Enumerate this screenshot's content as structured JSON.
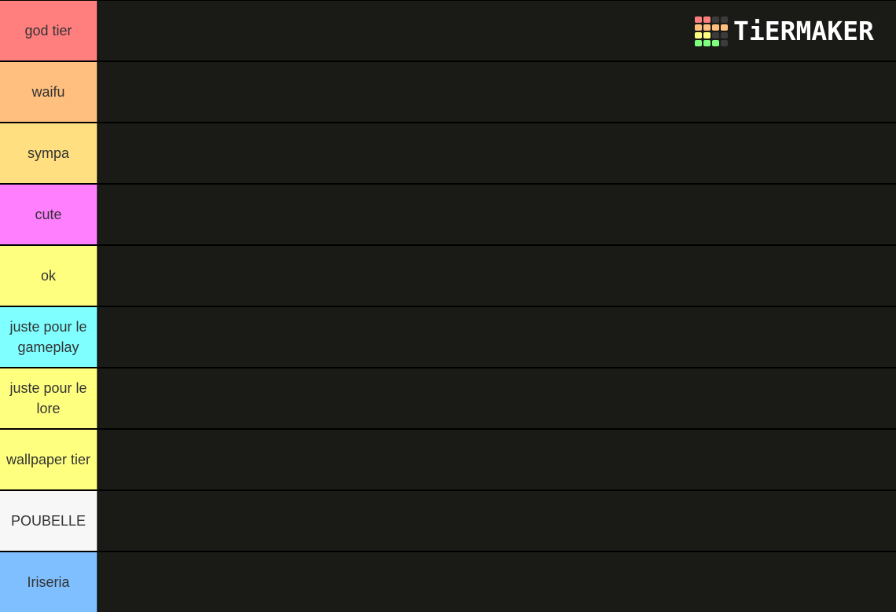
{
  "logo": {
    "text": "TiERMAKER",
    "grid_colors": [
      "#ff7f7f",
      "#ff7f7f",
      "#3b3b3b",
      "#3b3b3b",
      "#ffbf7f",
      "#ffbf7f",
      "#ffbf7f",
      "#ffbf7f",
      "#ffff7f",
      "#ffff7f",
      "#3b3b3b",
      "#3b3b3b",
      "#7fff7f",
      "#7fff7f",
      "#7fff7f",
      "#3b3b3b"
    ]
  },
  "tiers": [
    {
      "label": "god  tier",
      "color": "#ff7f7f"
    },
    {
      "label": "waifu",
      "color": "#ffbf7f"
    },
    {
      "label": "sympa",
      "color": "#ffdf7f"
    },
    {
      "label": "cute",
      "color": "#ff7fff"
    },
    {
      "label": "ok",
      "color": "#ffff7f"
    },
    {
      "label": "juste pour  le gameplay",
      "color": "#7fffff"
    },
    {
      "label": "juste pour le lore",
      "color": "#ffff7f"
    },
    {
      "label": "wallpaper tier",
      "color": "#ffff7f"
    },
    {
      "label": "POUBELLE",
      "color": "#f7f7f7"
    },
    {
      "label": "Iriseria",
      "color": "#7fbfff"
    }
  ]
}
